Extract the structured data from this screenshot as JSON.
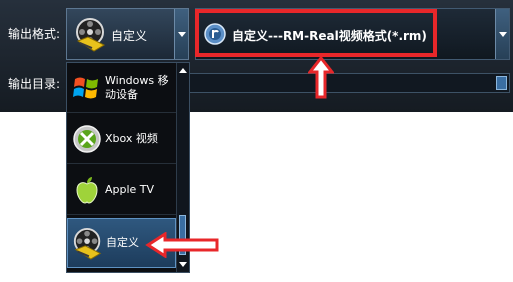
{
  "labels": {
    "output_format": "输出格式:",
    "output_dir": "输出目录:"
  },
  "format_select": {
    "value": "自定义",
    "icon": "film-reel-icon"
  },
  "preset_select": {
    "value": "自定义---RM-Real视频格式(*.rm)",
    "icon": "realmedia-icon"
  },
  "dropdown": {
    "items": [
      {
        "label": "Windows 移动设备",
        "icon": "windows-logo-icon"
      },
      {
        "label": "Xbox 视频",
        "icon": "xbox-logo-icon"
      },
      {
        "label": "Apple TV",
        "icon": "apple-logo-icon"
      },
      {
        "label": "自定义",
        "icon": "film-reel-icon",
        "selected": true
      }
    ]
  },
  "annotations": {
    "color": "#e8272a"
  }
}
